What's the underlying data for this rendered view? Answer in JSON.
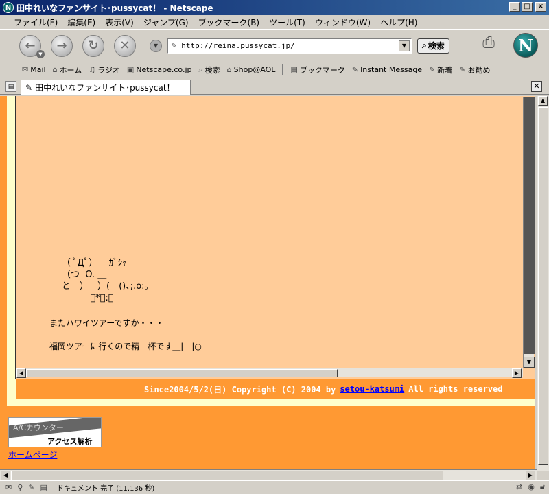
{
  "window": {
    "title": "田中れいなファンサイト･pussycat！ - Netscape",
    "app_icon": "N",
    "minimize": "_",
    "maximize": "□",
    "close": "×"
  },
  "menu": [
    "ファイル(F)",
    "編集(E)",
    "表示(V)",
    "ジャンプ(G)",
    "ブックマーク(B)",
    "ツール(T)",
    "ウィンドウ(W)",
    "ヘルプ(H)"
  ],
  "navigation": {
    "url": "http://reina.pussycat.jp/",
    "search_label": "検索",
    "logo": "N"
  },
  "personal_toolbar": [
    {
      "icon": "✉",
      "label": "Mail"
    },
    {
      "icon": "⌂",
      "label": "ホーム"
    },
    {
      "icon": "♫",
      "label": "ラジオ"
    },
    {
      "icon": "▣",
      "label": "Netscape.co.jp"
    },
    {
      "icon": "⌕",
      "label": "検索"
    },
    {
      "icon": "⌂",
      "label": "Shop@AOL"
    },
    {
      "icon": "▤",
      "label": "ブックマーク"
    },
    {
      "icon": "✎",
      "label": "Instant Message"
    },
    {
      "icon": "✎",
      "label": "新着"
    },
    {
      "icon": "✎",
      "label": "お勧め"
    }
  ],
  "tab": {
    "title": "田中れいなファンサイト･pussycat！"
  },
  "page": {
    "ascii_art": "  ＿＿\n（ ﾟДﾟ）    ｶﾞｼｬ\n（つ  O. ＿\nと＿）＿）(＿()､;.o:｡\n          ﾟ*･:｡",
    "message_1": "またハワイツアーですか・・・",
    "message_2": "福岡ツアーに行くので精一杯です＿|￣|○",
    "footer_before": "Since2004/5/2(日) Copyright (C) 2004 by",
    "footer_link": "setou-katsumi",
    "footer_after": "All rights reserved",
    "counter_label_1": "A/Cカウンター",
    "counter_label_2": "アクセス解析",
    "homepage_link": "ホームページ"
  },
  "status": {
    "text": "ドキュメント 完了 (11.136 秒)"
  }
}
